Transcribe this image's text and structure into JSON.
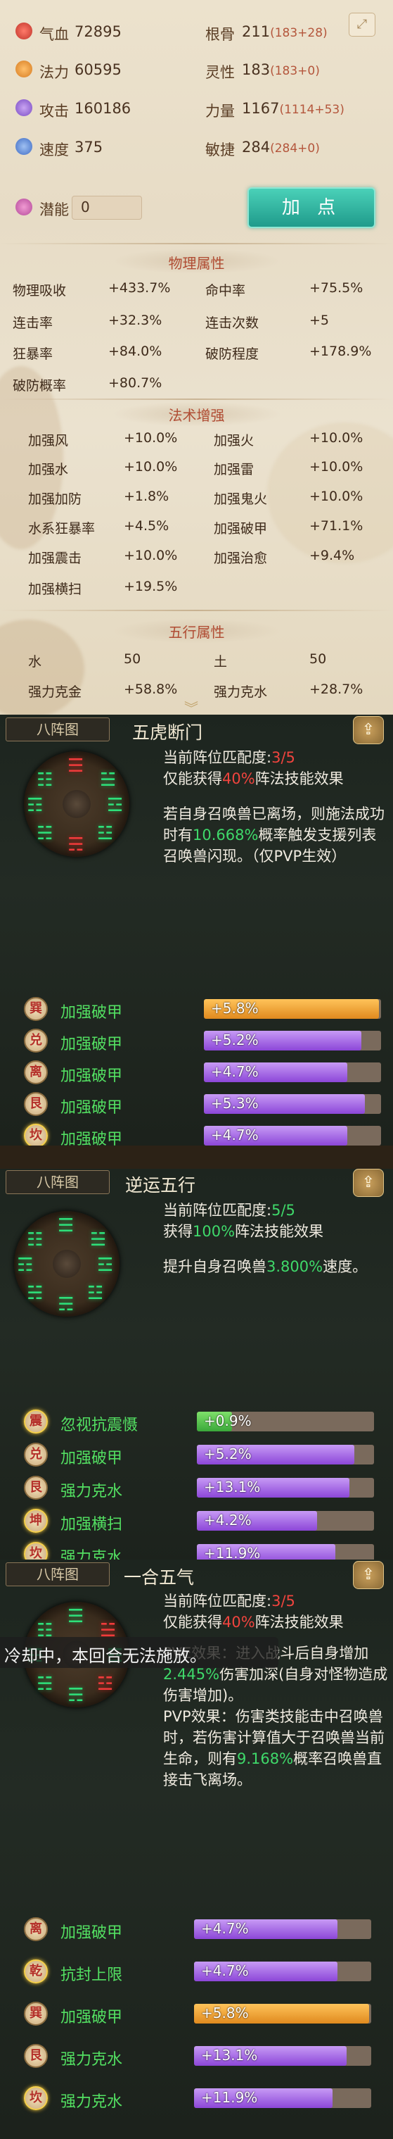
{
  "stats": [
    {
      "name": "气血",
      "value": "72895",
      "icon": "blood-drop-icon",
      "color": "#d8473c"
    },
    {
      "name": "法力",
      "value": "60595",
      "icon": "mana-swirl-icon",
      "color": "#e79a3c"
    },
    {
      "name": "攻击",
      "value": "160186",
      "icon": "sword-icon",
      "color": "#9b6dd6"
    },
    {
      "name": "速度",
      "value": "375",
      "icon": "speed-wing-icon",
      "color": "#5a86d6"
    }
  ],
  "attrs": [
    {
      "name": "根骨",
      "base": "211",
      "bonus": "(183+28)"
    },
    {
      "name": "灵性",
      "base": "183",
      "bonus": "(183+0)"
    },
    {
      "name": "力量",
      "base": "1167",
      "bonus": "(1114+53)"
    },
    {
      "name": "敏捷",
      "base": "284",
      "bonus": "(284+0)"
    }
  ],
  "potential": {
    "label": "潜能",
    "value": "0",
    "icon": "potential-orb-icon"
  },
  "add_point_label": "加 点",
  "physical": {
    "title": "物理属性",
    "items": [
      {
        "name": "物理吸收",
        "value": "+433.7%"
      },
      {
        "name": "命中率",
        "value": "+75.5%"
      },
      {
        "name": "连击率",
        "value": "+32.3%"
      },
      {
        "name": "连击次数",
        "value": "+5"
      },
      {
        "name": "狂暴率",
        "value": "+84.0%"
      },
      {
        "name": "破防程度",
        "value": "+178.9%"
      },
      {
        "name": "破防概率",
        "value": "+80.7%"
      }
    ]
  },
  "spell": {
    "title": "法术增强",
    "items": [
      {
        "name": "加强风",
        "value": "+10.0%"
      },
      {
        "name": "加强火",
        "value": "+10.0%"
      },
      {
        "name": "加强水",
        "value": "+10.0%"
      },
      {
        "name": "加强雷",
        "value": "+10.0%"
      },
      {
        "name": "加强加防",
        "value": "+1.8%"
      },
      {
        "name": "加强鬼火",
        "value": "+10.0%"
      },
      {
        "name": "水系狂暴率",
        "value": "+4.5%"
      },
      {
        "name": "加强破甲",
        "value": "+71.1%"
      },
      {
        "name": "加强震击",
        "value": "+10.0%"
      },
      {
        "name": "加强治愈",
        "value": "+9.4%"
      },
      {
        "name": "加强横扫",
        "value": "+19.5%"
      }
    ]
  },
  "five": {
    "title": "五行属性",
    "items": [
      {
        "name": "水",
        "value": "50"
      },
      {
        "name": "土",
        "value": "50"
      },
      {
        "name": "强力克金",
        "value": "+58.8%"
      },
      {
        "name": "强力克水",
        "value": "+28.7%"
      }
    ]
  },
  "formations": [
    {
      "tag": "八阵图",
      "title": "五虎断门",
      "match_label": "当前阵位匹配度:",
      "match_value": "3/5",
      "gain_pre": "仅能获得",
      "gain_pct": "40%",
      "gain_post": "阵法技能效果",
      "desc_pre": "若自身召唤兽已离场，则施法成功时有",
      "desc_pct": "10.668%",
      "desc_post": "概率触发支援列表召唤兽闪现。（仅PVP生效）",
      "rows": [
        {
          "rune": "巽",
          "name": "加强破甲",
          "value": "+5.8%",
          "level": 0.99,
          "color": "orange"
        },
        {
          "rune": "兑",
          "name": "加强破甲",
          "value": "+5.2%",
          "level": 0.89,
          "color": "purple"
        },
        {
          "rune": "离",
          "name": "加强破甲",
          "value": "+4.7%",
          "level": 0.81,
          "color": "purple"
        },
        {
          "rune": "艮",
          "name": "加强破甲",
          "value": "+5.3%",
          "level": 0.91,
          "color": "purple"
        },
        {
          "rune": "坎",
          "name": "加强破甲",
          "value": "+4.7%",
          "level": 0.81,
          "color": "purple"
        }
      ]
    },
    {
      "tag": "八阵图",
      "title": "逆运五行",
      "match_label": "当前阵位匹配度:",
      "match_value": "5/5",
      "gain_pre": "获得",
      "gain_pct": "100%",
      "gain_post": "阵法技能效果",
      "desc_pre": "提升自身召唤兽",
      "desc_pct": "3.800%",
      "desc_post": "速度。",
      "rows": [
        {
          "rune": "震",
          "name": "忽视抗震慑",
          "value": "+0.9%",
          "level": 0.2,
          "color": "green"
        },
        {
          "rune": "兑",
          "name": "加强破甲",
          "value": "+5.2%",
          "level": 0.89,
          "color": "purple"
        },
        {
          "rune": "艮",
          "name": "强力克水",
          "value": "+13.1%",
          "level": 0.86,
          "color": "purple"
        },
        {
          "rune": "坤",
          "name": "加强横扫",
          "value": "+4.2%",
          "level": 0.68,
          "color": "purple"
        },
        {
          "rune": "坎",
          "name": "强力克水",
          "value": "+11.9%",
          "level": 0.78,
          "color": "purple"
        }
      ]
    },
    {
      "tag": "八阵图",
      "title": "一合五气",
      "match_label": "当前阵位匹配度:",
      "match_value": "3/5",
      "gain_pre": "仅能获得",
      "gain_pct": "40%",
      "gain_post": "阵法技能效果",
      "desc_pve_pre": "PVE效果：进入战斗后自身增加",
      "desc_pve_pct": "2.445%",
      "desc_pve_post": "伤害加深(自身对怪物造成伤害增加)。",
      "desc_pvp_pre": "PVP效果：伤害类技能击中召唤兽时，若伤害计算值大于召唤兽当前生命，则有",
      "desc_pvp_pct": "9.168%",
      "desc_pvp_post": "概率召唤兽直接击飞离场。",
      "rows": [
        {
          "rune": "离",
          "name": "加强破甲",
          "value": "+4.7%",
          "level": 0.81,
          "color": "purple"
        },
        {
          "rune": "乾",
          "name": "抗封上限",
          "value": "+4.7%",
          "level": 0.81,
          "color": "purple"
        },
        {
          "rune": "巽",
          "name": "加强破甲",
          "value": "+5.8%",
          "level": 0.99,
          "color": "orange"
        },
        {
          "rune": "艮",
          "name": "强力克水",
          "value": "+13.1%",
          "level": 0.86,
          "color": "purple"
        },
        {
          "rune": "坎",
          "name": "强力克水",
          "value": "+11.9%",
          "level": 0.78,
          "color": "purple"
        }
      ]
    }
  ],
  "cooldown_text": "冷却中，本回合无法施放。"
}
